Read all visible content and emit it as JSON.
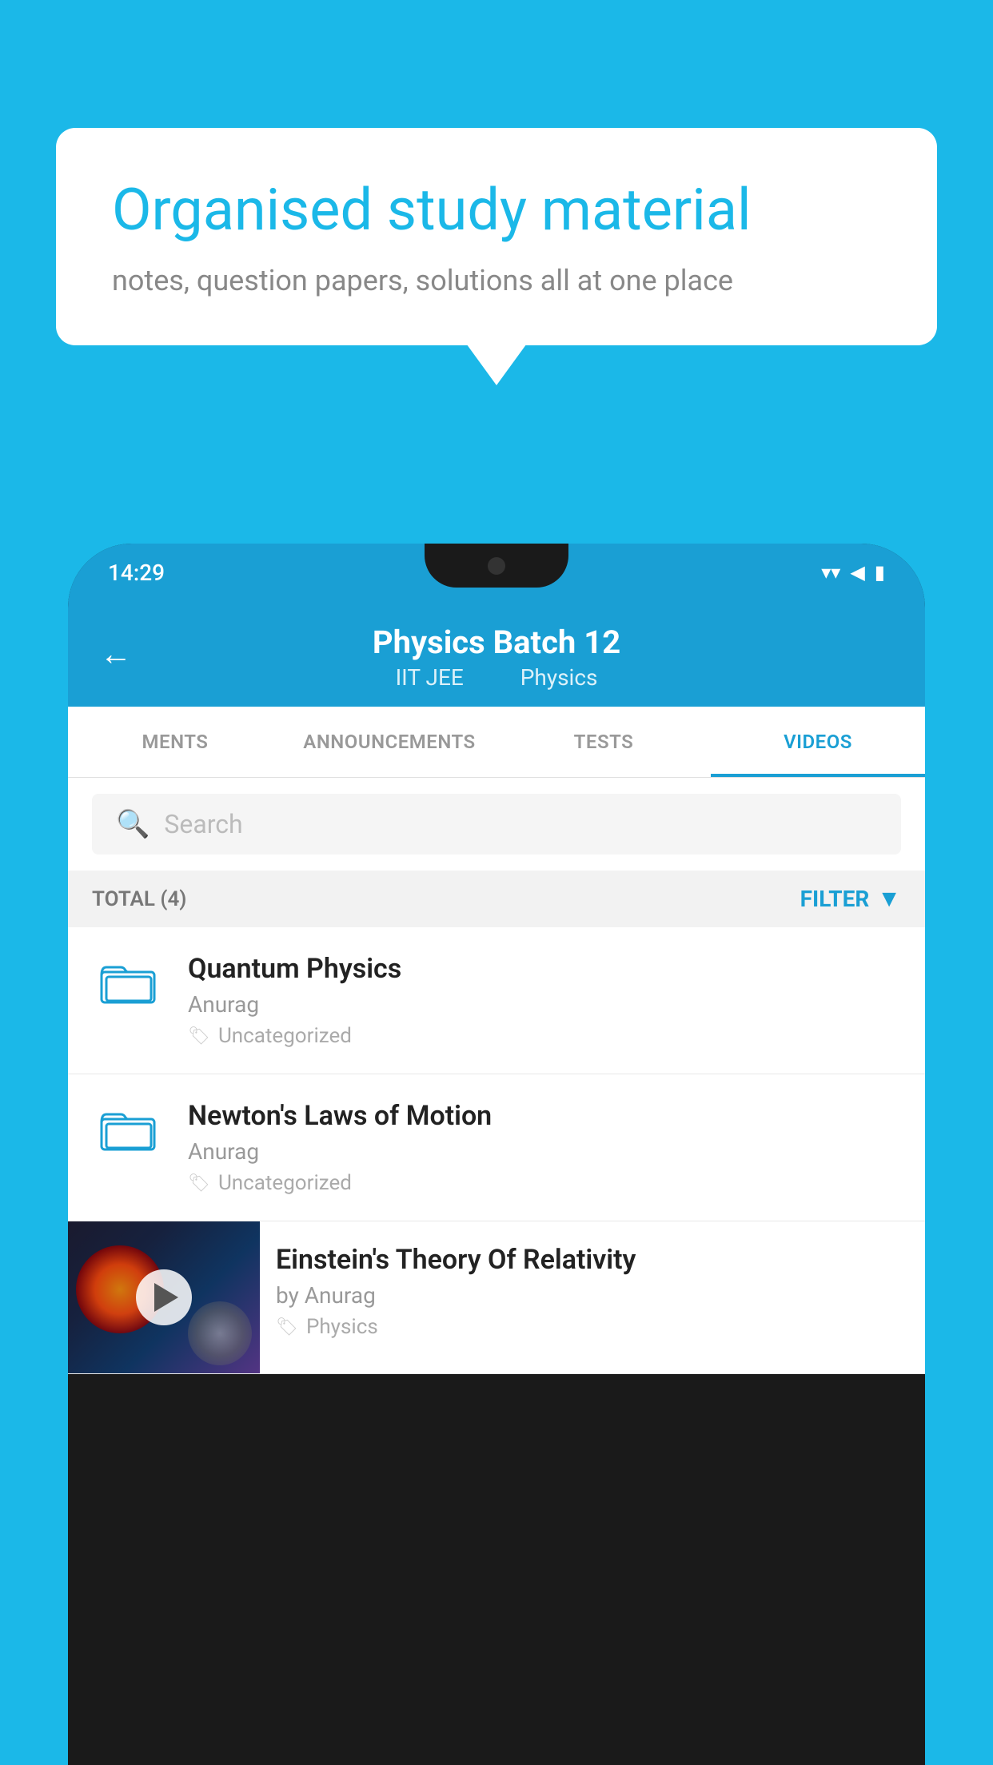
{
  "page": {
    "background_color": "#1bb8e8"
  },
  "speech_bubble": {
    "title": "Organised study material",
    "subtitle": "notes, question papers, solutions all at one place"
  },
  "phone": {
    "status_bar": {
      "time": "14:29",
      "icons": [
        "wifi",
        "signal",
        "battery"
      ]
    },
    "header": {
      "back_label": "←",
      "title": "Physics Batch 12",
      "subtitle_part1": "IIT JEE",
      "subtitle_part2": "Physics"
    },
    "tabs": [
      {
        "label": "MENTS",
        "active": false
      },
      {
        "label": "ANNOUNCEMENTS",
        "active": false
      },
      {
        "label": "TESTS",
        "active": false
      },
      {
        "label": "VIDEOS",
        "active": true
      }
    ],
    "search": {
      "placeholder": "Search"
    },
    "filter_bar": {
      "total_label": "TOTAL (4)",
      "filter_label": "FILTER"
    },
    "items": [
      {
        "type": "folder",
        "title": "Quantum Physics",
        "author": "Anurag",
        "tag": "Uncategorized"
      },
      {
        "type": "folder",
        "title": "Newton's Laws of Motion",
        "author": "Anurag",
        "tag": "Uncategorized"
      },
      {
        "type": "video",
        "title": "Einstein's Theory Of Relativity",
        "author": "by Anurag",
        "tag": "Physics",
        "has_thumbnail": true
      }
    ]
  }
}
